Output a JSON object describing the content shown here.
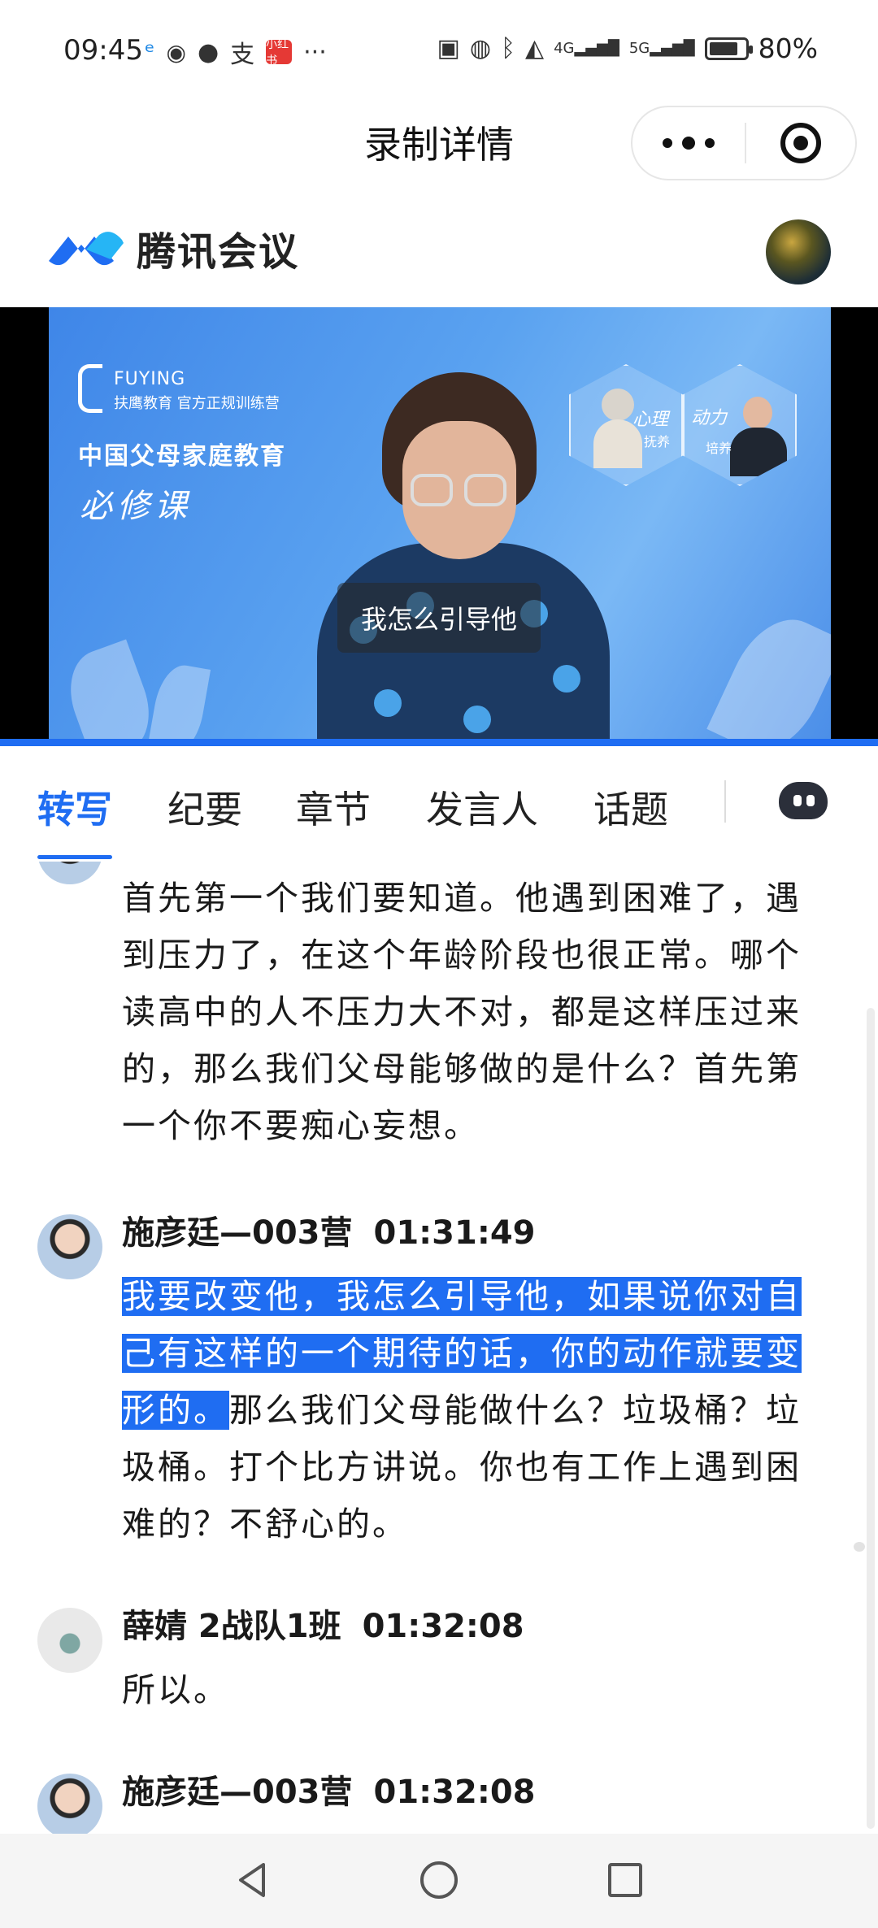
{
  "status_bar": {
    "time": "09:45",
    "left_icons": [
      "carrier-icon",
      "wechat-icon",
      "message-icon",
      "alipay-icon",
      "mini-app-icon",
      "more-dots"
    ],
    "alipay_glyph": "支",
    "mini_app_text": "小红书",
    "more": "···",
    "signal_4g": "4G",
    "signal_5g": "5G",
    "battery_percent": "80%",
    "battery_level": 0.8
  },
  "header": {
    "title": "录制详情"
  },
  "brand": {
    "name": "腾讯会议"
  },
  "video": {
    "logo_text": "FUYING",
    "logo_sub": "扶鹰教育  官方正规训练营",
    "headline": "中国父母家庭教育",
    "calligraphy": "必修课",
    "hex_label_1": "心理",
    "hex_label_1b": "抚养",
    "hex_label_2": "动力",
    "hex_label_2b": "培养",
    "caption": "我怎么引导他",
    "progress": 1.0
  },
  "tabs": [
    {
      "label": "转写",
      "active": true
    },
    {
      "label": "纪要",
      "active": false
    },
    {
      "label": "章节",
      "active": false
    },
    {
      "label": "发言人",
      "active": false
    },
    {
      "label": "话题",
      "active": false
    }
  ],
  "transcript": {
    "entry0": {
      "text": "首先第一个我们要知道。他遇到困难了，遇到压力了，在这个年龄阶段也很正常。哪个读高中的人不压力大不对，都是这样压过来的，那么我们父母能够做的是什么？首先第一个你不要痴心妄想。"
    },
    "entry1": {
      "speaker": "施彦廷—003营",
      "time": "01:31:49",
      "text_highlighted": "我要改变他，我怎么引导他，如果说你对自己有这样的一个期待的话，你的动作就要变形的。",
      "text_rest": "那么我们父母能做什么？垃圾桶？垃圾桶。打个比方讲说。你也有工作上遇到困难的？不舒心的。"
    },
    "entry2": {
      "speaker": "薛婧 2战队1班",
      "time": "01:32:08",
      "text": "所以。"
    },
    "entry3": {
      "speaker": "施彦廷—003营",
      "time": "01:32:08"
    }
  }
}
